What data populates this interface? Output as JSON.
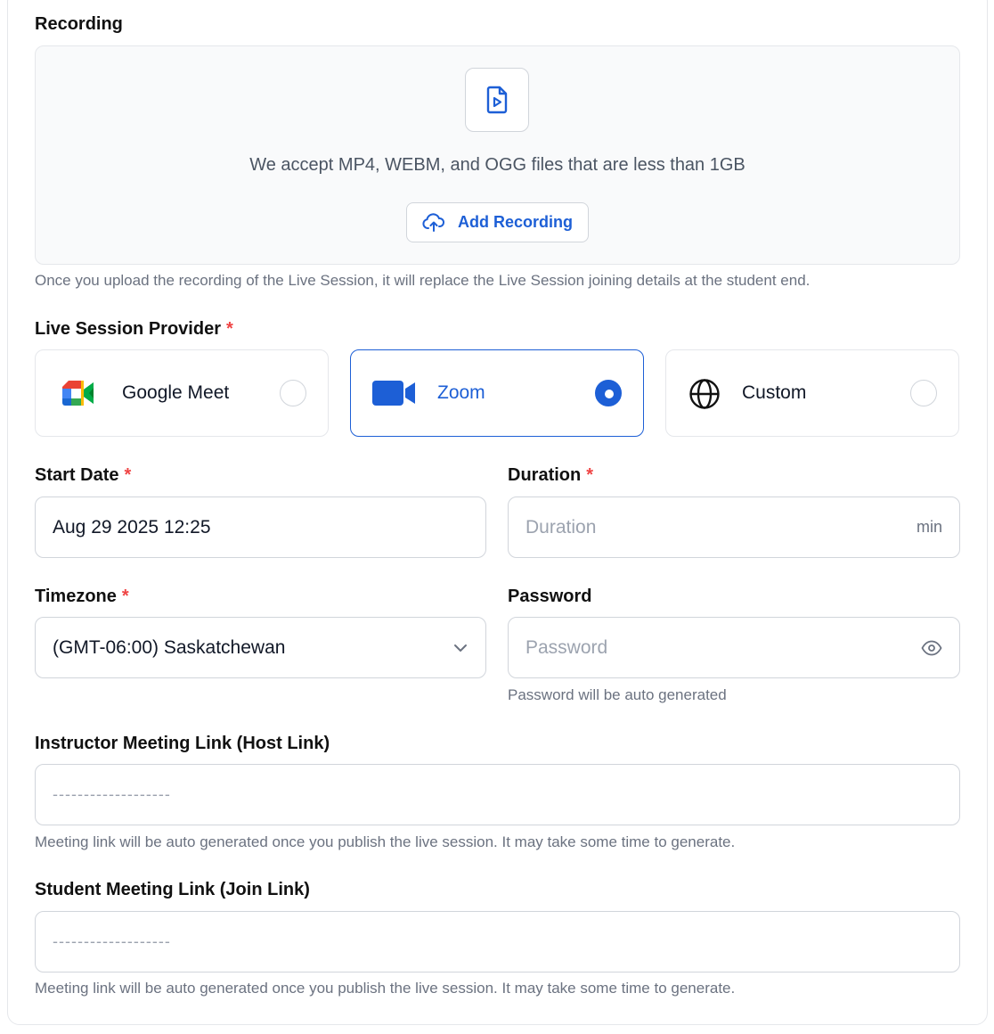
{
  "recording": {
    "label": "Recording",
    "accept_text": "We accept MP4, WEBM, and OGG files that are less than 1GB",
    "add_button": "Add Recording",
    "helper": "Once you upload the recording of the Live Session, it will replace the Live Session joining details at the student end."
  },
  "provider": {
    "label": "Live Session Provider",
    "required_mark": "*",
    "options": [
      {
        "name": "Google Meet",
        "icon": "google-meet-icon",
        "selected": false
      },
      {
        "name": "Zoom",
        "icon": "zoom-icon",
        "selected": true
      },
      {
        "name": "Custom",
        "icon": "globe-icon",
        "selected": false
      }
    ]
  },
  "start_date": {
    "label": "Start Date",
    "required_mark": "*",
    "value": "Aug 29 2025 12:25"
  },
  "duration": {
    "label": "Duration",
    "required_mark": "*",
    "placeholder": "Duration",
    "suffix": "min"
  },
  "timezone": {
    "label": "Timezone",
    "required_mark": "*",
    "value": "(GMT-06:00) Saskatchewan"
  },
  "password": {
    "label": "Password",
    "placeholder": "Password",
    "helper": "Password will be auto generated"
  },
  "host_link": {
    "label": "Instructor Meeting Link (Host Link)",
    "placeholder": "-------------------",
    "helper": "Meeting link will be auto generated once you publish the live session. It may take some time to generate."
  },
  "join_link": {
    "label": "Student Meeting Link (Join Link)",
    "placeholder": "-------------------",
    "helper": "Meeting link will be auto generated once you publish the live session. It may take some time to generate."
  },
  "colors": {
    "accent": "#1d5fd6",
    "required": "#ef4444",
    "border": "#d1d5db"
  }
}
